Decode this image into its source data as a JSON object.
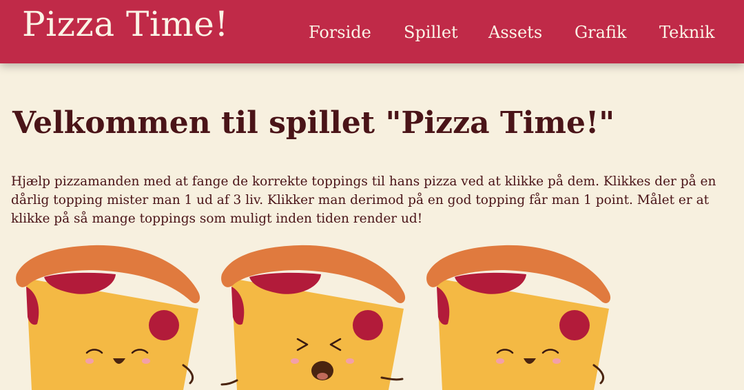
{
  "header": {
    "logo": "Pizza Time!",
    "nav": [
      {
        "label": "Forside"
      },
      {
        "label": "Spillet"
      },
      {
        "label": "Assets"
      },
      {
        "label": "Grafik"
      },
      {
        "label": "Teknik"
      }
    ]
  },
  "main": {
    "title": "Velkommen til spillet \"Pizza Time!\"",
    "intro": "Hjælp pizzamanden med at fange de korrekte toppings til hans pizza ved at klikke på dem. Klikkes der på en dårlig topping mister man 1 ud af 3 liv. Klikker man derimod på en god topping får man 1 point. Målet er at klikke på så mange toppings som muligt inden tiden render ud!"
  },
  "colors": {
    "header_bg": "#c02a48",
    "page_bg": "#f7f0df",
    "text": "#4a1418",
    "crust": "#e07a3e",
    "cheese": "#f4b944",
    "pepperoni": "#b21b3a"
  },
  "illustrations": [
    {
      "name": "happy-pizza-character",
      "expression": "happy"
    },
    {
      "name": "shouting-pizza-character",
      "expression": "shouting"
    },
    {
      "name": "happy-pizza-character",
      "expression": "happy"
    }
  ]
}
